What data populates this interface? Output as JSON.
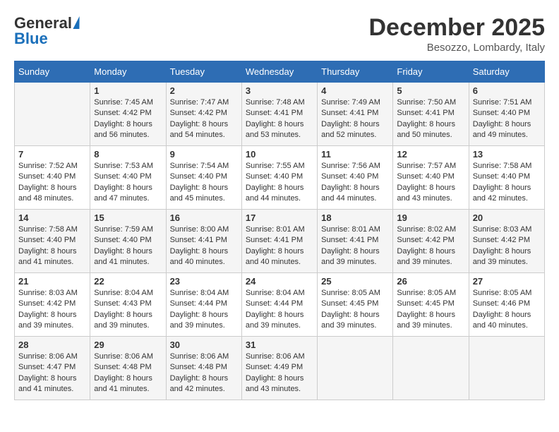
{
  "logo": {
    "general": "General",
    "blue": "Blue"
  },
  "title": "December 2025",
  "location": "Besozzo, Lombardy, Italy",
  "days_header": [
    "Sunday",
    "Monday",
    "Tuesday",
    "Wednesday",
    "Thursday",
    "Friday",
    "Saturday"
  ],
  "weeks": [
    [
      {
        "day": "",
        "sunrise": "",
        "sunset": "",
        "daylight": ""
      },
      {
        "day": "1",
        "sunrise": "Sunrise: 7:45 AM",
        "sunset": "Sunset: 4:42 PM",
        "daylight": "Daylight: 8 hours and 56 minutes."
      },
      {
        "day": "2",
        "sunrise": "Sunrise: 7:47 AM",
        "sunset": "Sunset: 4:42 PM",
        "daylight": "Daylight: 8 hours and 54 minutes."
      },
      {
        "day": "3",
        "sunrise": "Sunrise: 7:48 AM",
        "sunset": "Sunset: 4:41 PM",
        "daylight": "Daylight: 8 hours and 53 minutes."
      },
      {
        "day": "4",
        "sunrise": "Sunrise: 7:49 AM",
        "sunset": "Sunset: 4:41 PM",
        "daylight": "Daylight: 8 hours and 52 minutes."
      },
      {
        "day": "5",
        "sunrise": "Sunrise: 7:50 AM",
        "sunset": "Sunset: 4:41 PM",
        "daylight": "Daylight: 8 hours and 50 minutes."
      },
      {
        "day": "6",
        "sunrise": "Sunrise: 7:51 AM",
        "sunset": "Sunset: 4:40 PM",
        "daylight": "Daylight: 8 hours and 49 minutes."
      }
    ],
    [
      {
        "day": "7",
        "sunrise": "Sunrise: 7:52 AM",
        "sunset": "Sunset: 4:40 PM",
        "daylight": "Daylight: 8 hours and 48 minutes."
      },
      {
        "day": "8",
        "sunrise": "Sunrise: 7:53 AM",
        "sunset": "Sunset: 4:40 PM",
        "daylight": "Daylight: 8 hours and 47 minutes."
      },
      {
        "day": "9",
        "sunrise": "Sunrise: 7:54 AM",
        "sunset": "Sunset: 4:40 PM",
        "daylight": "Daylight: 8 hours and 45 minutes."
      },
      {
        "day": "10",
        "sunrise": "Sunrise: 7:55 AM",
        "sunset": "Sunset: 4:40 PM",
        "daylight": "Daylight: 8 hours and 44 minutes."
      },
      {
        "day": "11",
        "sunrise": "Sunrise: 7:56 AM",
        "sunset": "Sunset: 4:40 PM",
        "daylight": "Daylight: 8 hours and 44 minutes."
      },
      {
        "day": "12",
        "sunrise": "Sunrise: 7:57 AM",
        "sunset": "Sunset: 4:40 PM",
        "daylight": "Daylight: 8 hours and 43 minutes."
      },
      {
        "day": "13",
        "sunrise": "Sunrise: 7:58 AM",
        "sunset": "Sunset: 4:40 PM",
        "daylight": "Daylight: 8 hours and 42 minutes."
      }
    ],
    [
      {
        "day": "14",
        "sunrise": "Sunrise: 7:58 AM",
        "sunset": "Sunset: 4:40 PM",
        "daylight": "Daylight: 8 hours and 41 minutes."
      },
      {
        "day": "15",
        "sunrise": "Sunrise: 7:59 AM",
        "sunset": "Sunset: 4:40 PM",
        "daylight": "Daylight: 8 hours and 41 minutes."
      },
      {
        "day": "16",
        "sunrise": "Sunrise: 8:00 AM",
        "sunset": "Sunset: 4:41 PM",
        "daylight": "Daylight: 8 hours and 40 minutes."
      },
      {
        "day": "17",
        "sunrise": "Sunrise: 8:01 AM",
        "sunset": "Sunset: 4:41 PM",
        "daylight": "Daylight: 8 hours and 40 minutes."
      },
      {
        "day": "18",
        "sunrise": "Sunrise: 8:01 AM",
        "sunset": "Sunset: 4:41 PM",
        "daylight": "Daylight: 8 hours and 39 minutes."
      },
      {
        "day": "19",
        "sunrise": "Sunrise: 8:02 AM",
        "sunset": "Sunset: 4:42 PM",
        "daylight": "Daylight: 8 hours and 39 minutes."
      },
      {
        "day": "20",
        "sunrise": "Sunrise: 8:03 AM",
        "sunset": "Sunset: 4:42 PM",
        "daylight": "Daylight: 8 hours and 39 minutes."
      }
    ],
    [
      {
        "day": "21",
        "sunrise": "Sunrise: 8:03 AM",
        "sunset": "Sunset: 4:42 PM",
        "daylight": "Daylight: 8 hours and 39 minutes."
      },
      {
        "day": "22",
        "sunrise": "Sunrise: 8:04 AM",
        "sunset": "Sunset: 4:43 PM",
        "daylight": "Daylight: 8 hours and 39 minutes."
      },
      {
        "day": "23",
        "sunrise": "Sunrise: 8:04 AM",
        "sunset": "Sunset: 4:44 PM",
        "daylight": "Daylight: 8 hours and 39 minutes."
      },
      {
        "day": "24",
        "sunrise": "Sunrise: 8:04 AM",
        "sunset": "Sunset: 4:44 PM",
        "daylight": "Daylight: 8 hours and 39 minutes."
      },
      {
        "day": "25",
        "sunrise": "Sunrise: 8:05 AM",
        "sunset": "Sunset: 4:45 PM",
        "daylight": "Daylight: 8 hours and 39 minutes."
      },
      {
        "day": "26",
        "sunrise": "Sunrise: 8:05 AM",
        "sunset": "Sunset: 4:45 PM",
        "daylight": "Daylight: 8 hours and 39 minutes."
      },
      {
        "day": "27",
        "sunrise": "Sunrise: 8:05 AM",
        "sunset": "Sunset: 4:46 PM",
        "daylight": "Daylight: 8 hours and 40 minutes."
      }
    ],
    [
      {
        "day": "28",
        "sunrise": "Sunrise: 8:06 AM",
        "sunset": "Sunset: 4:47 PM",
        "daylight": "Daylight: 8 hours and 41 minutes."
      },
      {
        "day": "29",
        "sunrise": "Sunrise: 8:06 AM",
        "sunset": "Sunset: 4:48 PM",
        "daylight": "Daylight: 8 hours and 41 minutes."
      },
      {
        "day": "30",
        "sunrise": "Sunrise: 8:06 AM",
        "sunset": "Sunset: 4:48 PM",
        "daylight": "Daylight: 8 hours and 42 minutes."
      },
      {
        "day": "31",
        "sunrise": "Sunrise: 8:06 AM",
        "sunset": "Sunset: 4:49 PM",
        "daylight": "Daylight: 8 hours and 43 minutes."
      },
      {
        "day": "",
        "sunrise": "",
        "sunset": "",
        "daylight": ""
      },
      {
        "day": "",
        "sunrise": "",
        "sunset": "",
        "daylight": ""
      },
      {
        "day": "",
        "sunrise": "",
        "sunset": "",
        "daylight": ""
      }
    ]
  ]
}
